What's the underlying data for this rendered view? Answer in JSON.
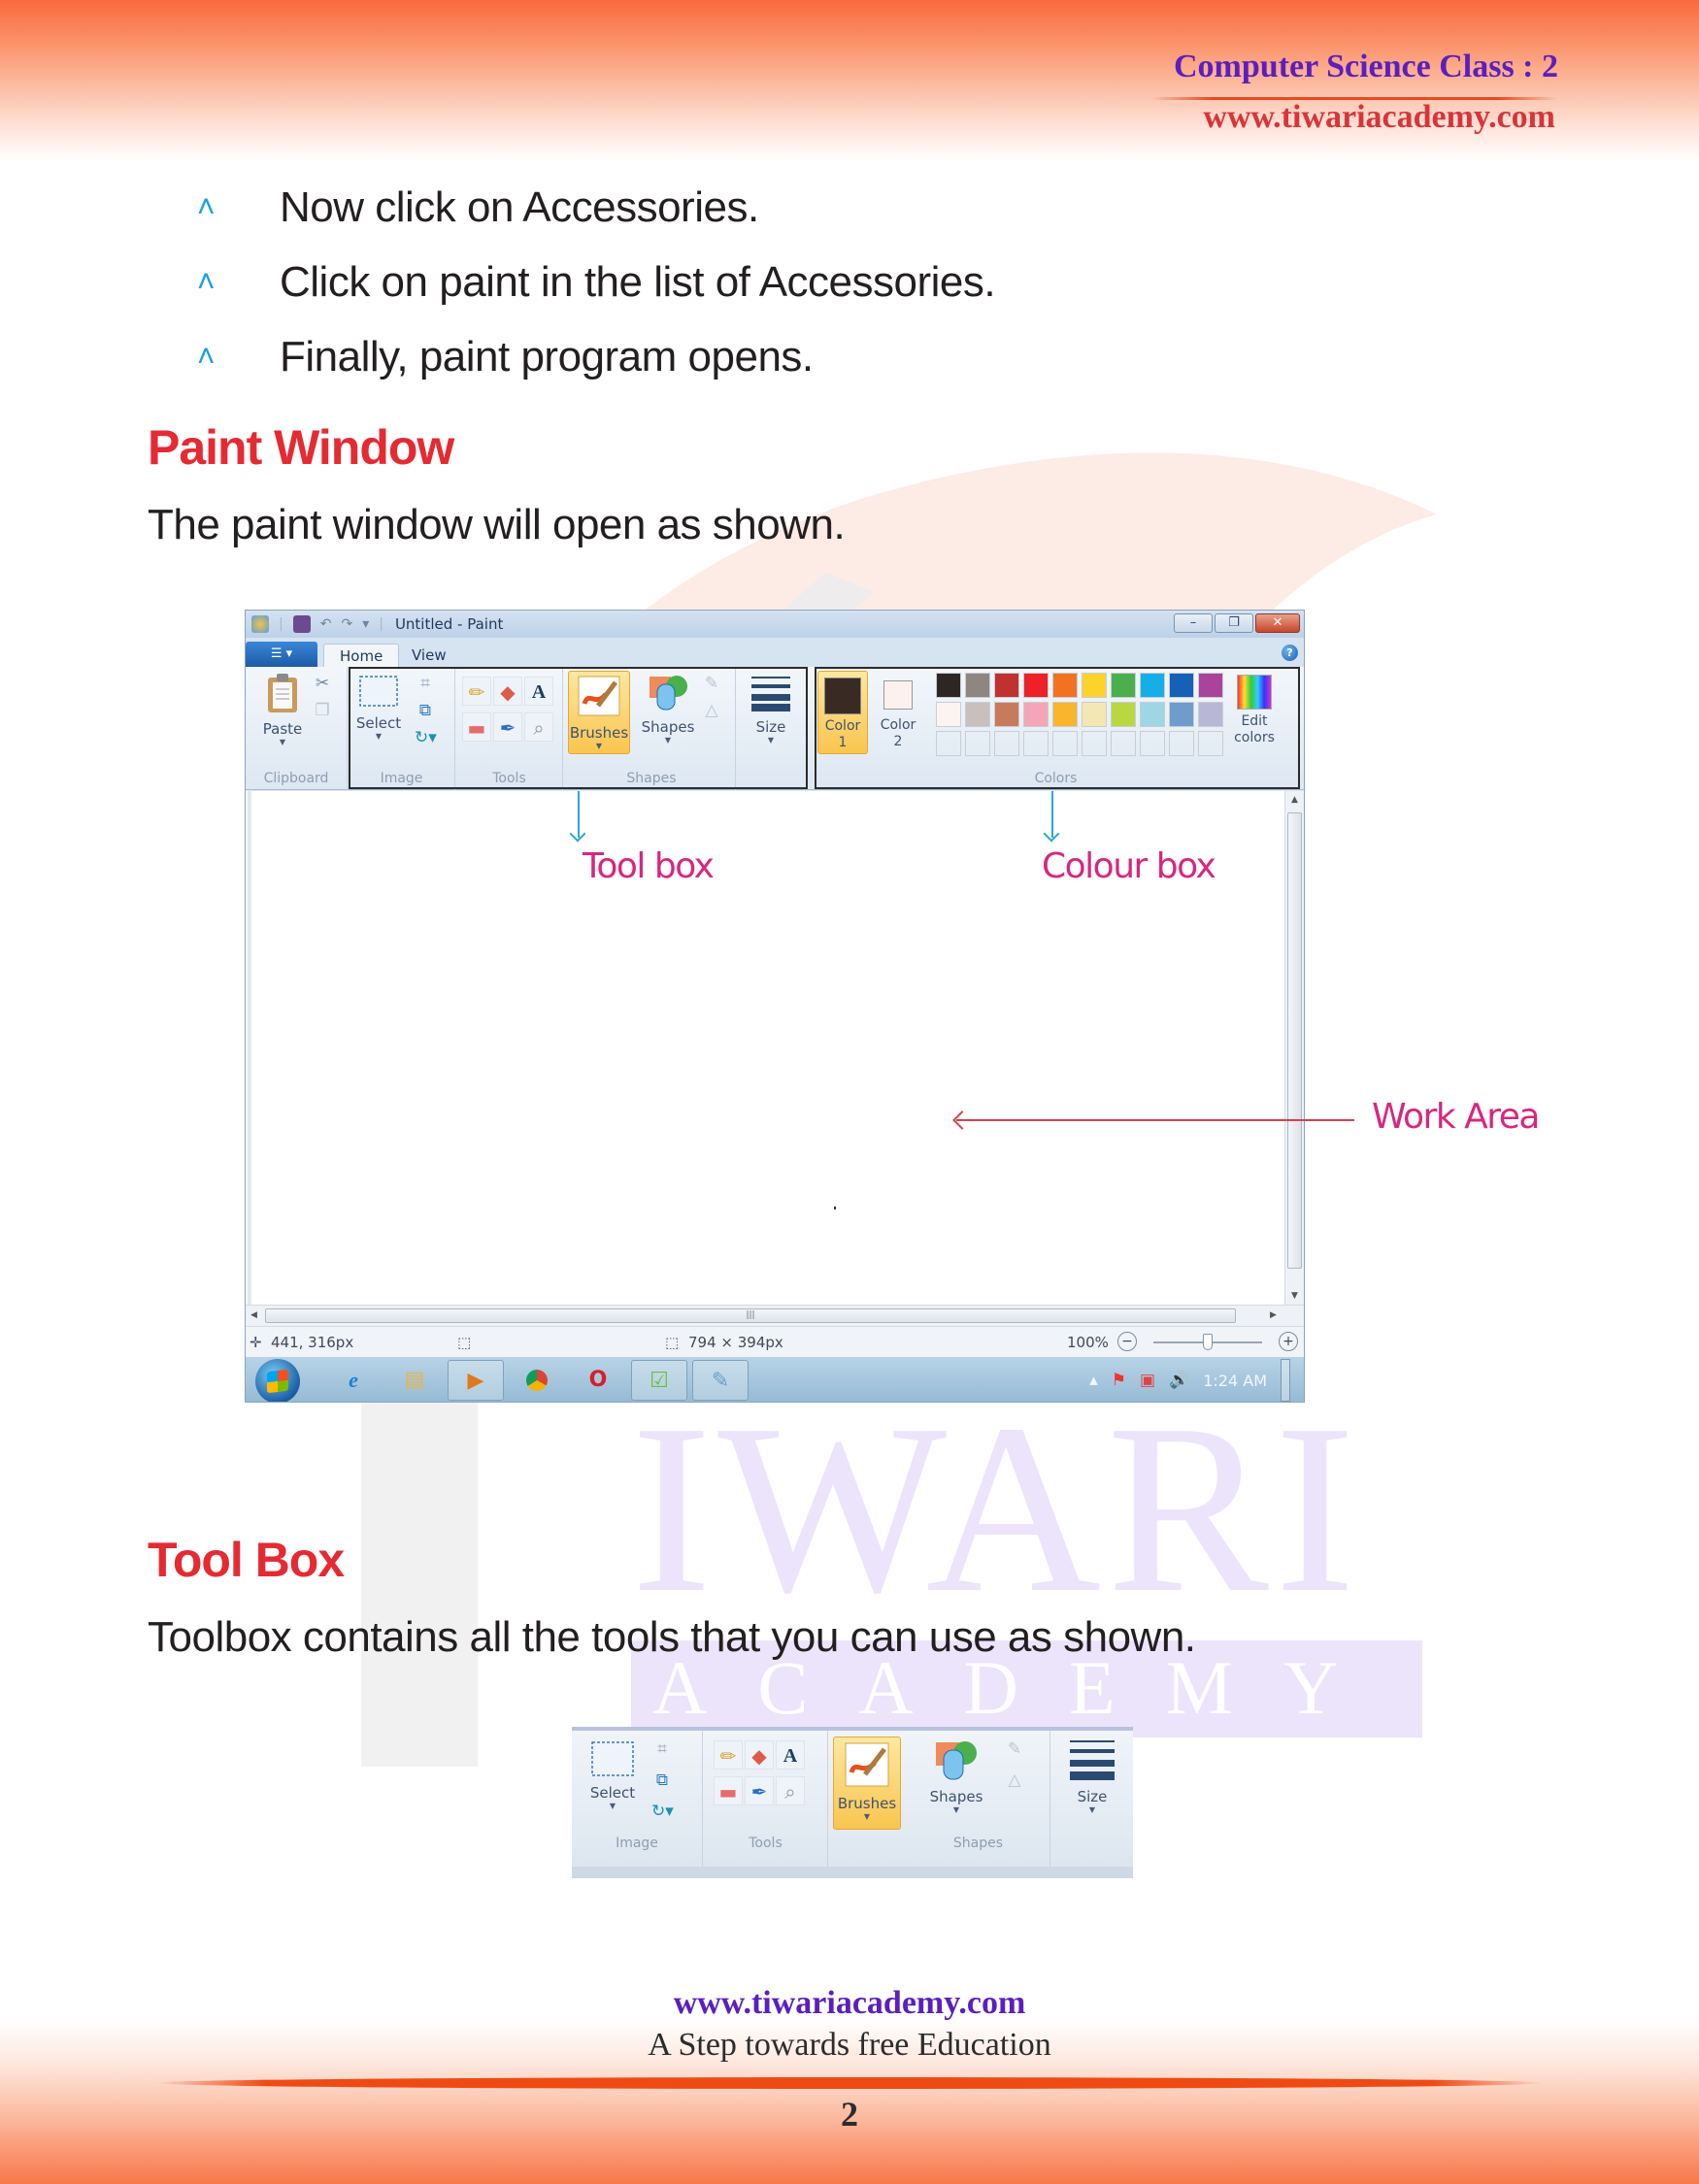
{
  "header": {
    "class_title": "Computer Science Class : 2",
    "website": "www.tiwariacademy.com"
  },
  "watermark": {
    "big_text": "IWARI",
    "sub_text": "ACADEMY"
  },
  "bullets": [
    {
      "icon": "arrowhead-bullet-icon",
      "text": "Now click on Accessories."
    },
    {
      "icon": "arrowhead-bullet-icon",
      "text": "Click on paint in the list of Accessories."
    },
    {
      "icon": "arrowhead-bullet-icon",
      "text": "Finally, paint program opens."
    }
  ],
  "section_paint_window": {
    "heading": "Paint Window",
    "paragraph": "The paint window will open as shown."
  },
  "paint": {
    "title": "Untitled - Paint",
    "window_buttons": {
      "minimize": "–",
      "restore": "❐",
      "close": "✕"
    },
    "app_menu_label": "☰ ▾",
    "tabs": [
      {
        "label": "Home",
        "active": true
      },
      {
        "label": "View",
        "active": false
      }
    ],
    "help": "?",
    "groups": {
      "clipboard": {
        "label": "Clipboard",
        "paste": "Paste"
      },
      "image": {
        "label": "Image",
        "select": "Select"
      },
      "tools": {
        "label": "Tools"
      },
      "brushes": {
        "label": "Brushes"
      },
      "shapes": {
        "label": "Shapes",
        "shapes": "Shapes"
      },
      "size": {
        "label": "Size"
      },
      "colors": {
        "label": "Colors",
        "color1": "Color 1",
        "color2": "Color 2",
        "edit_colors": "Edit colors",
        "color1_value": "#3a2a24",
        "color2_value": "#fdf1ef",
        "palette_row1": [
          "#2e2624",
          "#8f8581",
          "#c1312f",
          "#ed2126",
          "#f37221",
          "#fcd22b",
          "#4ab04b",
          "#16aee7",
          "#1561b5",
          "#a9439b"
        ],
        "palette_row2": [
          "#fdf3f1",
          "#c9c0bd",
          "#c87b5b",
          "#f3a6b6",
          "#f9b52b",
          "#f3e7b4",
          "#b8d840",
          "#9ed6e3",
          "#6f9ccb",
          "#b9b7d6"
        ]
      }
    },
    "status": {
      "cursor_pos": "441, 316px",
      "canvas_size": "794 × 394px",
      "zoom": "100%",
      "zoom_fraction": 0.5
    },
    "taskbar": {
      "time": "1:24 AM"
    }
  },
  "annotations": {
    "tool_box": "Tool box",
    "colour_box": "Colour box",
    "work_area": "Work Area"
  },
  "section_tool_box": {
    "heading": "Tool Box",
    "paragraph": "Toolbox contains all the tools that you can use as shown.",
    "image_group_label": "Image",
    "tools_group_label": "Tools",
    "shapes_group_label": "Shapes",
    "select": "Select",
    "brushes": "Brushes",
    "shapes": "Shapes",
    "size": "Size"
  },
  "footer": {
    "website": "www.tiwariacademy.com",
    "tagline": "A Step towards free Education",
    "page_number": "2"
  }
}
